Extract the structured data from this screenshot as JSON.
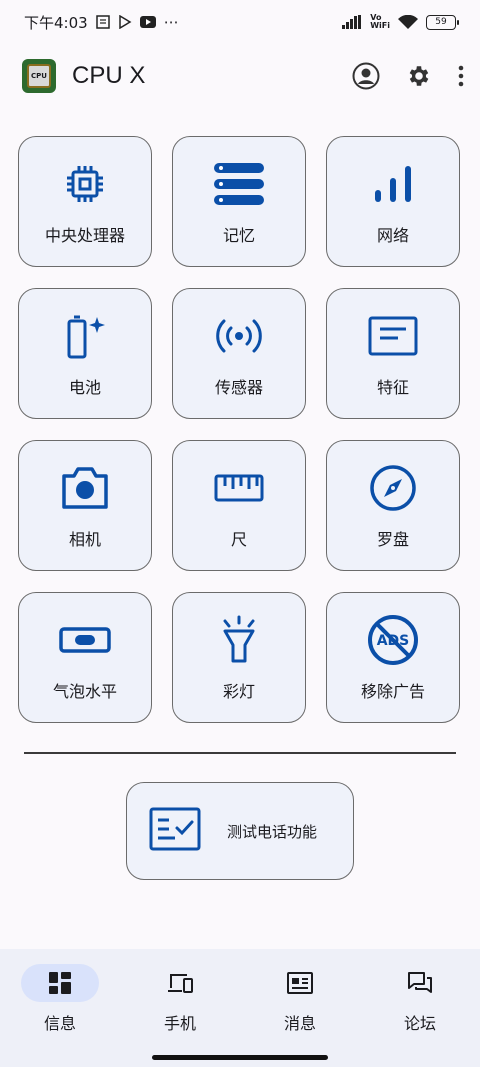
{
  "status_bar": {
    "time": "下午4:03",
    "more": "⋯",
    "vo": "Vo",
    "wifi_text": "WiFi",
    "battery": "59"
  },
  "app_bar": {
    "title": "CPU X",
    "logo_text": "CPU"
  },
  "tiles": [
    {
      "label": "中央处理器",
      "icon": "cpu-icon"
    },
    {
      "label": "记忆",
      "icon": "memory-icon"
    },
    {
      "label": "网络",
      "icon": "network-signal-icon"
    },
    {
      "label": "电池",
      "icon": "battery-icon"
    },
    {
      "label": "传感器",
      "icon": "sensor-icon"
    },
    {
      "label": "特征",
      "icon": "feature-card-icon"
    },
    {
      "label": "相机",
      "icon": "camera-icon"
    },
    {
      "label": "尺",
      "icon": "ruler-icon"
    },
    {
      "label": "罗盘",
      "icon": "compass-icon"
    },
    {
      "label": "气泡水平",
      "icon": "bubble-level-icon"
    },
    {
      "label": "彩灯",
      "icon": "flashlight-icon"
    },
    {
      "label": "移除广告",
      "icon": "remove-ads-icon"
    }
  ],
  "test_button": {
    "label": "测试电话功能",
    "icon": "checklist-icon"
  },
  "bottom_nav": [
    {
      "label": "信息",
      "icon": "dashboard-icon",
      "active": true
    },
    {
      "label": "手机",
      "icon": "devices-icon",
      "active": false
    },
    {
      "label": "消息",
      "icon": "news-icon",
      "active": false
    },
    {
      "label": "论坛",
      "icon": "forum-icon",
      "active": false
    }
  ],
  "colors": {
    "accent": "#0b4fa8",
    "tile_bg": "#eff2fa",
    "nav_active_pill": "#d9e2fb"
  }
}
